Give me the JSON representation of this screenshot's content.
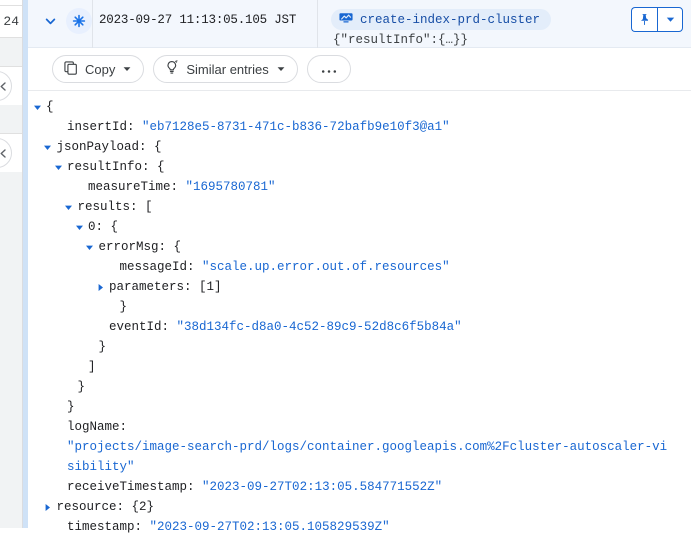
{
  "left_rail": {
    "row_number": "24",
    "collapse_handles": [
      {
        "name": "collapse-left-panel-top",
        "glyph": "chevron-left"
      },
      {
        "name": "collapse-left-panel-bottom",
        "glyph": "chevron-left"
      }
    ]
  },
  "header": {
    "expand_caret": "chevron-down",
    "sparkle_icon": "sparkle-icon",
    "timestamp": "2023-09-27 11:13:05.105 JST",
    "chip": {
      "icon": "cluster-icon",
      "label": "create-index-prd-cluster"
    },
    "summary": "{\"resultInfo\":{…}}",
    "actions": [
      {
        "name": "pin-button",
        "icon": "pin-icon"
      },
      {
        "name": "more-actions-dropdown",
        "icon": "chevron-down-icon"
      }
    ]
  },
  "toolbar": {
    "copy_label": "Copy",
    "similar_entries_label": "Similar entries",
    "more_label": "•••"
  },
  "colors": {
    "accent_blue": "#1967d2",
    "chip_bg": "#e3edfa",
    "chip_text": "#174ea6",
    "header_bg": "#f3f7fd",
    "rail_stripe": "#cfe2f7"
  },
  "json_tree": [
    {
      "indent": 0,
      "caret": "expanded",
      "key": "",
      "punct": "{"
    },
    {
      "indent": 1,
      "caret": "none",
      "key": "insertId",
      "value": "\"eb7128e5-8731-471c-b836-72bafb9e10f3@a1\""
    },
    {
      "indent": 0.5,
      "caret": "expanded",
      "key": "jsonPayload",
      "punct": "{"
    },
    {
      "indent": 1,
      "caret": "expanded",
      "key": "resultInfo",
      "punct": "{"
    },
    {
      "indent": 2,
      "caret": "none",
      "key": "measureTime",
      "value": "\"1695780781\""
    },
    {
      "indent": 1.5,
      "caret": "expanded",
      "key": "results",
      "punct": "["
    },
    {
      "indent": 2,
      "caret": "expanded",
      "key": "0",
      "punct": "{"
    },
    {
      "indent": 2.5,
      "caret": "expanded",
      "key": "errorMsg",
      "punct": "{"
    },
    {
      "indent": 3.5,
      "caret": "none",
      "key": "messageId",
      "value": "\"scale.up.error.out.of.resources\""
    },
    {
      "indent": 3,
      "caret": "collapsed",
      "key": "parameters",
      "punct": "[1]"
    },
    {
      "indent": 3.5,
      "caret": "none",
      "key": "",
      "punct": "}"
    },
    {
      "indent": 3,
      "caret": "none",
      "key": "eventId",
      "value": "\"38d134fc-d8a0-4c52-89c9-52d8c6f5b84a\""
    },
    {
      "indent": 2.5,
      "caret": "none",
      "key": "",
      "punct": "}"
    },
    {
      "indent": 2,
      "caret": "none",
      "key": "",
      "punct": "]"
    },
    {
      "indent": 1.5,
      "caret": "none",
      "key": "",
      "punct": "}"
    },
    {
      "indent": 1,
      "caret": "none",
      "key": "",
      "punct": "}"
    },
    {
      "indent": 1,
      "caret": "none",
      "key": "logName",
      "value": ""
    },
    {
      "indent": 1,
      "caret": "none",
      "key": "",
      "wrapvalue": "\"projects/image-search-prd/logs/container.googleapis.com%2Fcluster-autoscaler-visibility\""
    },
    {
      "indent": 1,
      "caret": "none",
      "key": "receiveTimestamp",
      "value": "\"2023-09-27T02:13:05.584771552Z\""
    },
    {
      "indent": 0.5,
      "caret": "collapsed",
      "key": "resource",
      "punct": "{2}"
    },
    {
      "indent": 1,
      "caret": "none",
      "key": "timestamp",
      "value": "\"2023-09-27T02:13:05.105829539Z\""
    }
  ]
}
